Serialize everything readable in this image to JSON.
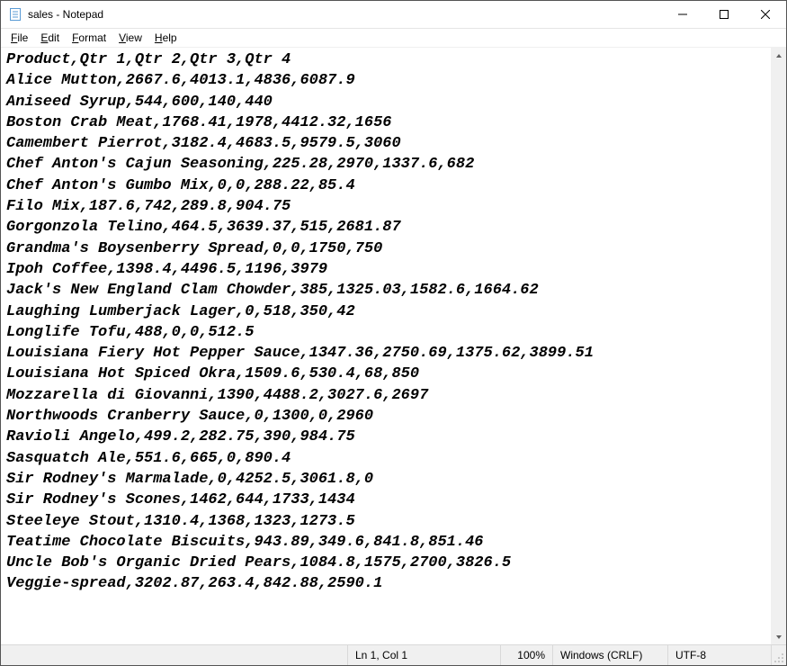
{
  "title": "sales - Notepad",
  "menu": {
    "file": "File",
    "edit": "Edit",
    "format": "Format",
    "view": "View",
    "help": "Help"
  },
  "content": "Product,Qtr 1,Qtr 2,Qtr 3,Qtr 4\nAlice Mutton,2667.6,4013.1,4836,6087.9\nAniseed Syrup,544,600,140,440\nBoston Crab Meat,1768.41,1978,4412.32,1656\nCamembert Pierrot,3182.4,4683.5,9579.5,3060\nChef Anton's Cajun Seasoning,225.28,2970,1337.6,682\nChef Anton's Gumbo Mix,0,0,288.22,85.4\nFilo Mix,187.6,742,289.8,904.75\nGorgonzola Telino,464.5,3639.37,515,2681.87\nGrandma's Boysenberry Spread,0,0,1750,750\nIpoh Coffee,1398.4,4496.5,1196,3979\nJack's New England Clam Chowder,385,1325.03,1582.6,1664.62\nLaughing Lumberjack Lager,0,518,350,42\nLonglife Tofu,488,0,0,512.5\nLouisiana Fiery Hot Pepper Sauce,1347.36,2750.69,1375.62,3899.51\nLouisiana Hot Spiced Okra,1509.6,530.4,68,850\nMozzarella di Giovanni,1390,4488.2,3027.6,2697\nNorthwoods Cranberry Sauce,0,1300,0,2960\nRavioli Angelo,499.2,282.75,390,984.75\nSasquatch Ale,551.6,665,0,890.4\nSir Rodney's Marmalade,0,4252.5,3061.8,0\nSir Rodney's Scones,1462,644,1733,1434\nSteeleye Stout,1310.4,1368,1323,1273.5\nTeatime Chocolate Biscuits,943.89,349.6,841.8,851.46\nUncle Bob's Organic Dried Pears,1084.8,1575,2700,3826.5\nVeggie-spread,3202.87,263.4,842.88,2590.1",
  "status": {
    "lncol": "Ln 1, Col 1",
    "zoom": "100%",
    "eol": "Windows (CRLF)",
    "encoding": "UTF-8"
  }
}
